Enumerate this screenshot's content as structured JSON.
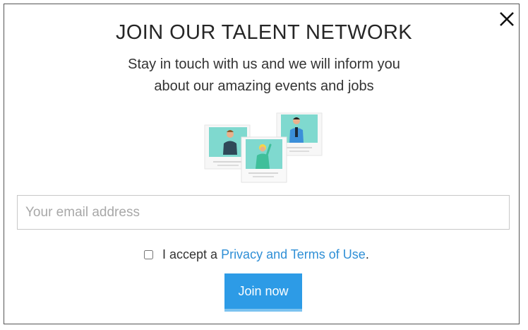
{
  "modal": {
    "title": "JOIN OUR TALENT NETWORK",
    "subtitle_line1": "Stay in touch with us and we will inform you",
    "subtitle_line2": "about our amazing events and jobs",
    "close_icon": "close-icon",
    "illustration_icon": "people-cards-illustration"
  },
  "form": {
    "email_placeholder": "Your email address",
    "email_value": "",
    "consent_prefix": "I accept a ",
    "consent_link": "Privacy and Terms of Use",
    "consent_suffix": ".",
    "consent_checked": false,
    "submit_label": "Join now"
  },
  "colors": {
    "accent": "#2d9be6",
    "link": "#2f8fd6",
    "card_teal": "#7fd9cf"
  }
}
